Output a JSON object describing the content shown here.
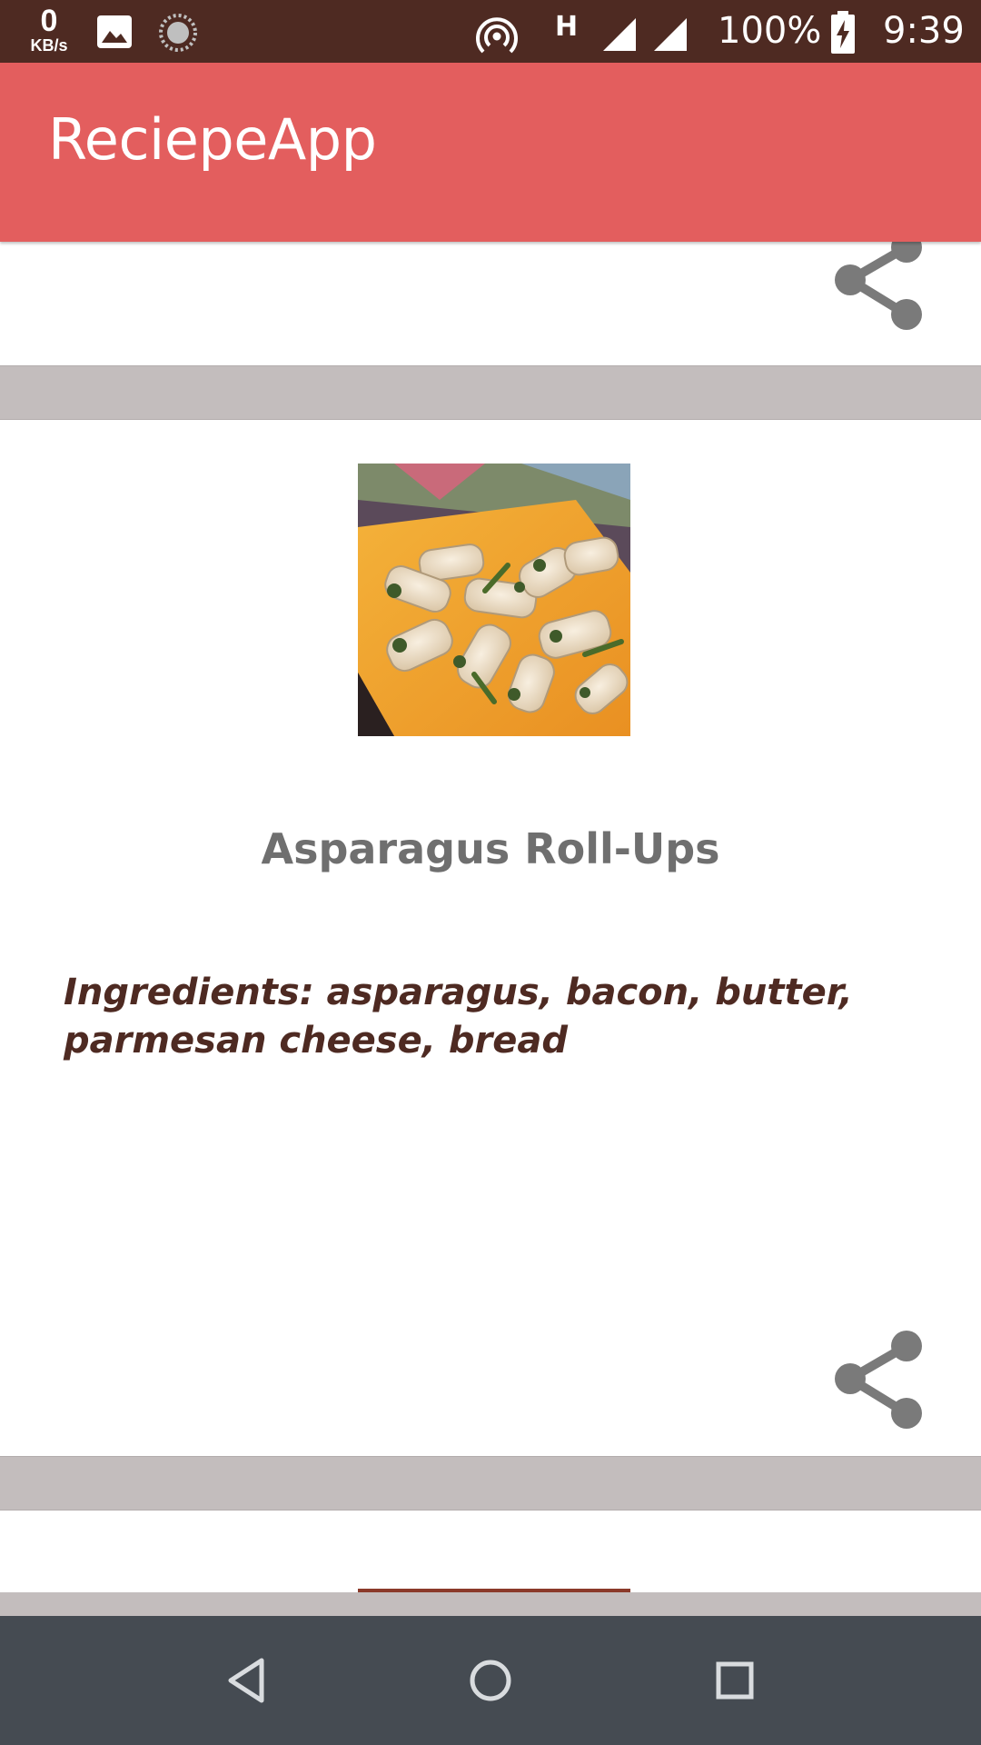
{
  "status_bar": {
    "net_speed_value": "0",
    "net_speed_unit": "KB/s",
    "network_type": "H",
    "battery": "100%",
    "time": "9:39",
    "icons": [
      "image-icon",
      "sync-icon",
      "hotspot-icon",
      "signal-icon",
      "signal-icon",
      "battery-charging-icon"
    ]
  },
  "app_bar": {
    "title": "ReciepeApp"
  },
  "recipe": {
    "title": "Asparagus Roll-Ups",
    "ingredients": "Ingredients: asparagus, bacon, butter, parmesan cheese, bread",
    "image_icon": "recipe-photo"
  },
  "actions": {
    "share_icon": "share-icon"
  },
  "nav_bar": {
    "icons": [
      "back-icon",
      "home-icon",
      "recents-icon"
    ]
  },
  "colors": {
    "status_bar": "#4e2a22",
    "app_bar": "#e35e5e",
    "divider": "#c3bdbd",
    "title_text": "#6f6f6f",
    "ingredients_text": "#4e2a22",
    "share_icon": "#7a7a7a",
    "nav_bar": "#454b52"
  }
}
